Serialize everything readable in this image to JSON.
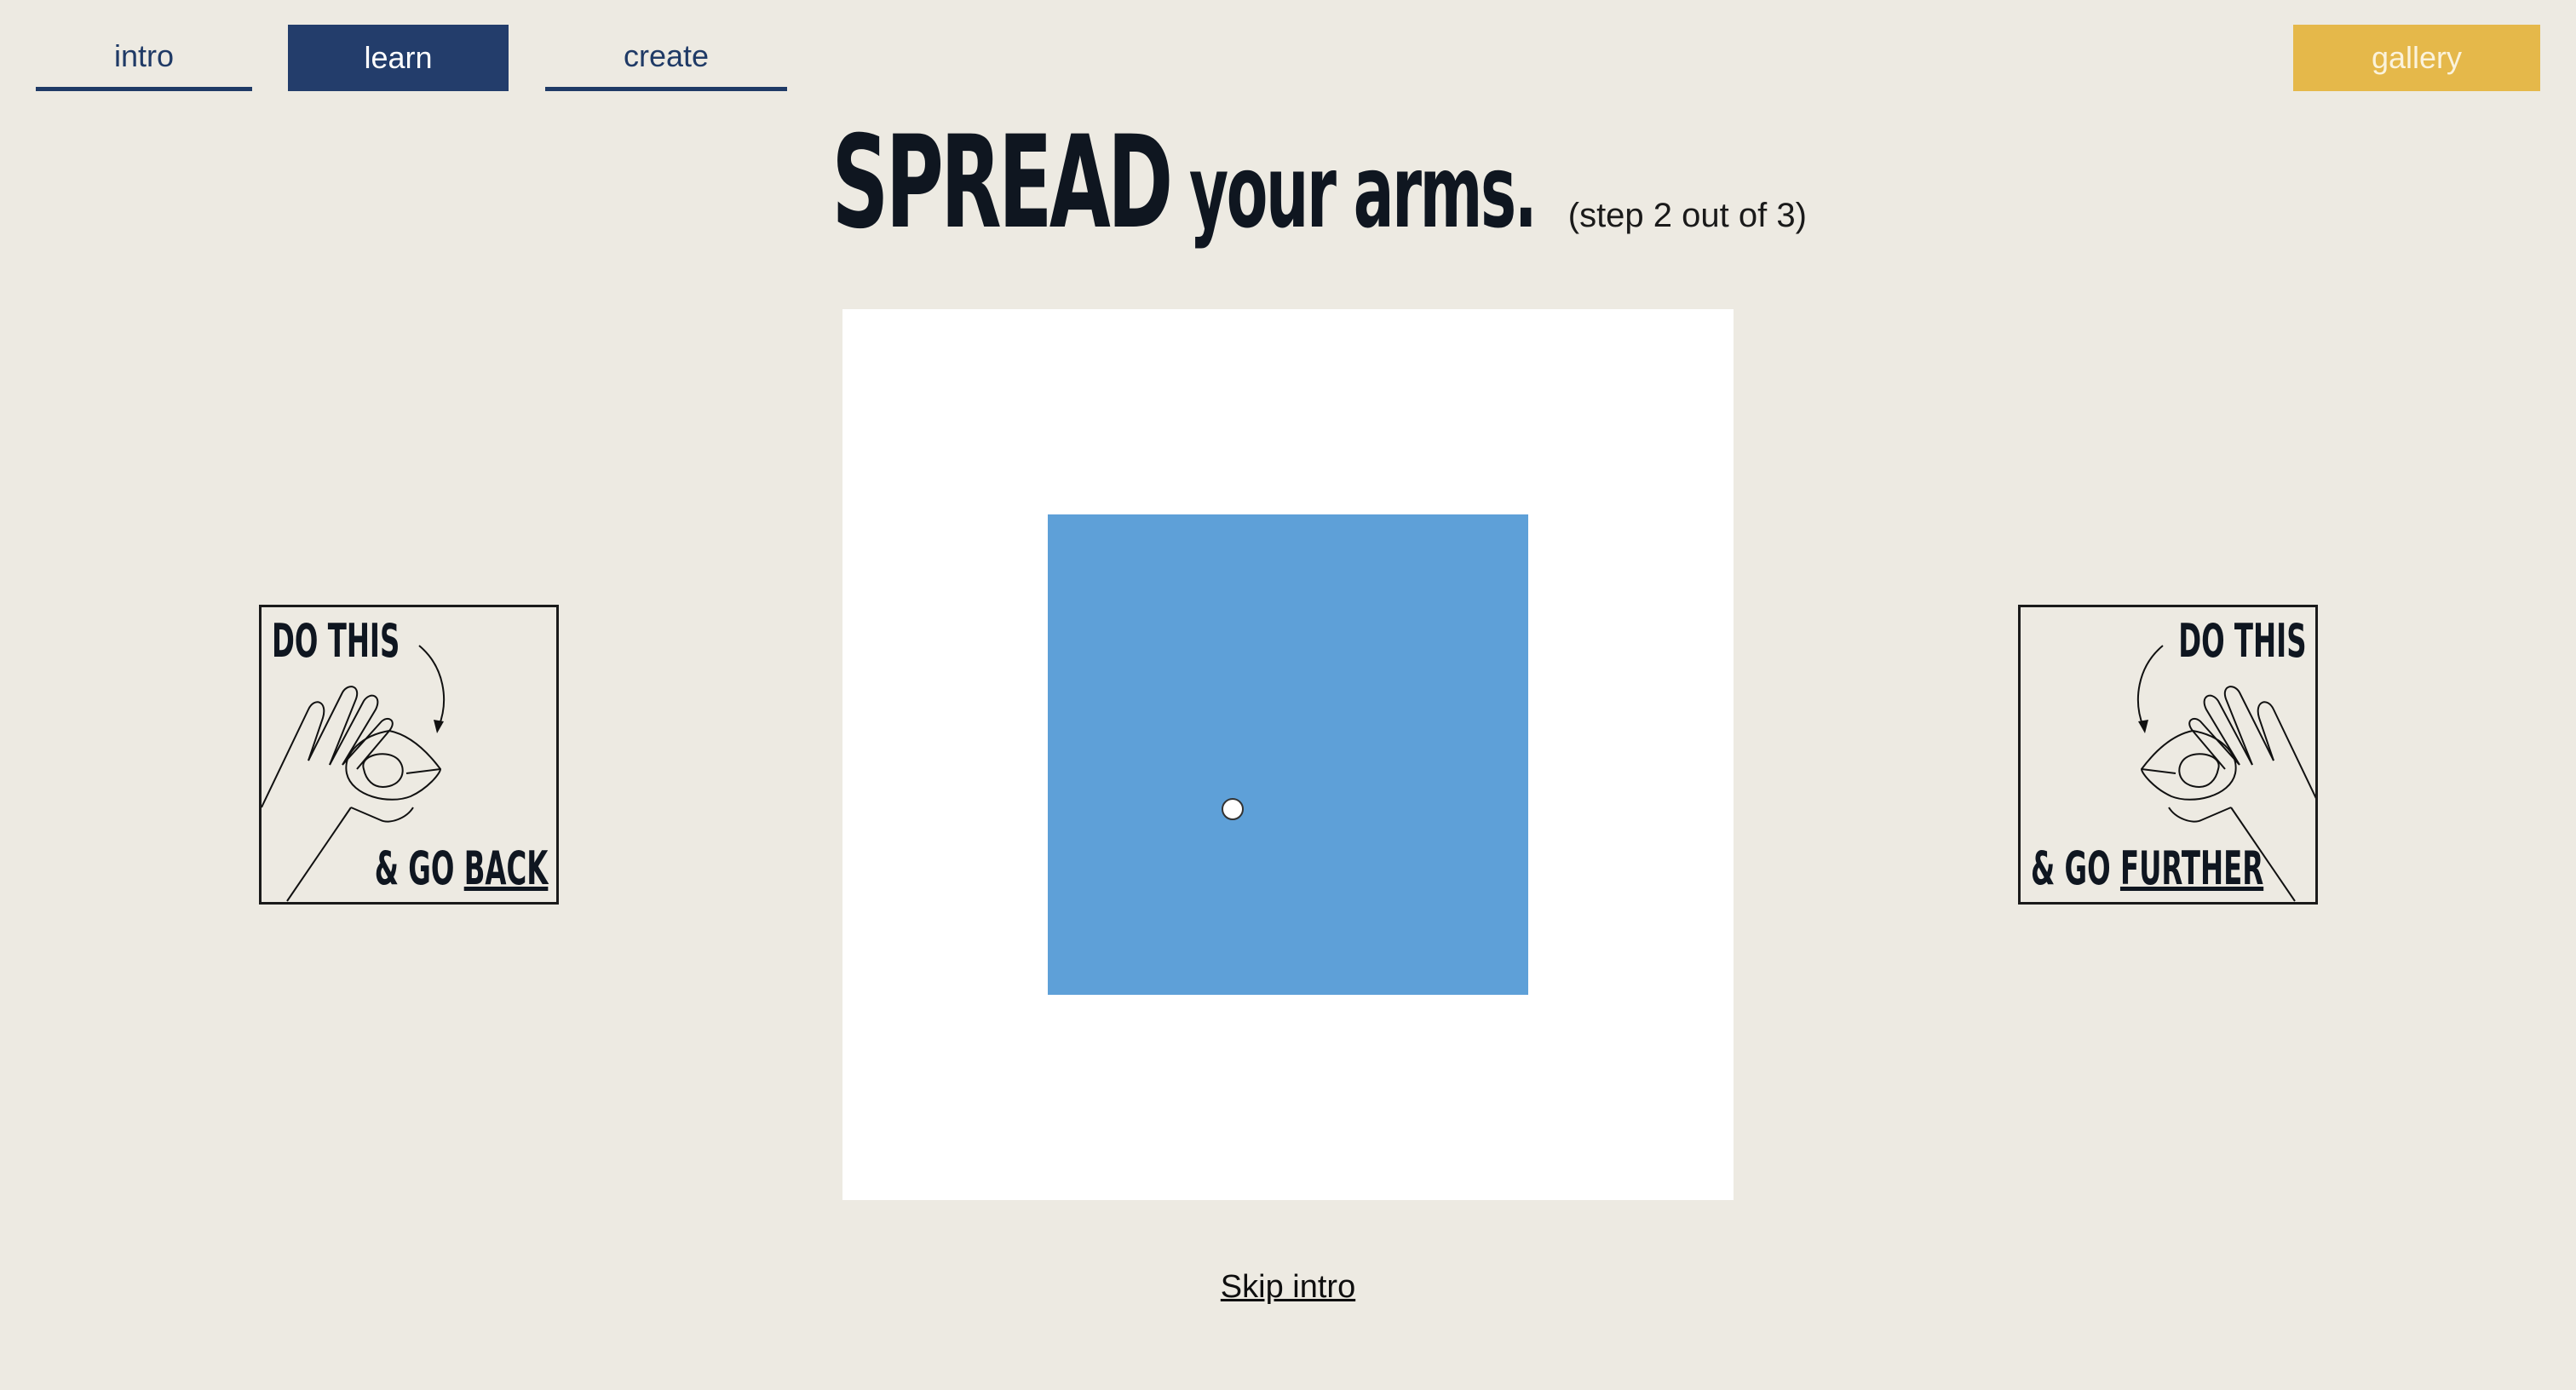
{
  "nav": {
    "tabs": [
      {
        "label": "intro",
        "active": false
      },
      {
        "label": "learn",
        "active": true
      },
      {
        "label": "create",
        "active": false
      }
    ],
    "gallery_label": "gallery"
  },
  "heading": {
    "emphasis": "SPREAD",
    "rest": "your arms.",
    "step": "(step 2 out of 3)"
  },
  "cards": {
    "back": {
      "top": "DO THIS",
      "bottom_prefix": "& GO ",
      "bottom_action": "BACK",
      "icon": "ok-hand-gesture-icon"
    },
    "further": {
      "top": "DO THIS",
      "bottom_prefix": "& GO ",
      "bottom_action": "FURTHER",
      "icon": "ok-hand-gesture-icon"
    }
  },
  "skip_label": "Skip intro",
  "colors": {
    "background": "#edeae2",
    "nav_active": "#233d6b",
    "gallery": "#e5b84a",
    "square": "#5ea0d8"
  }
}
